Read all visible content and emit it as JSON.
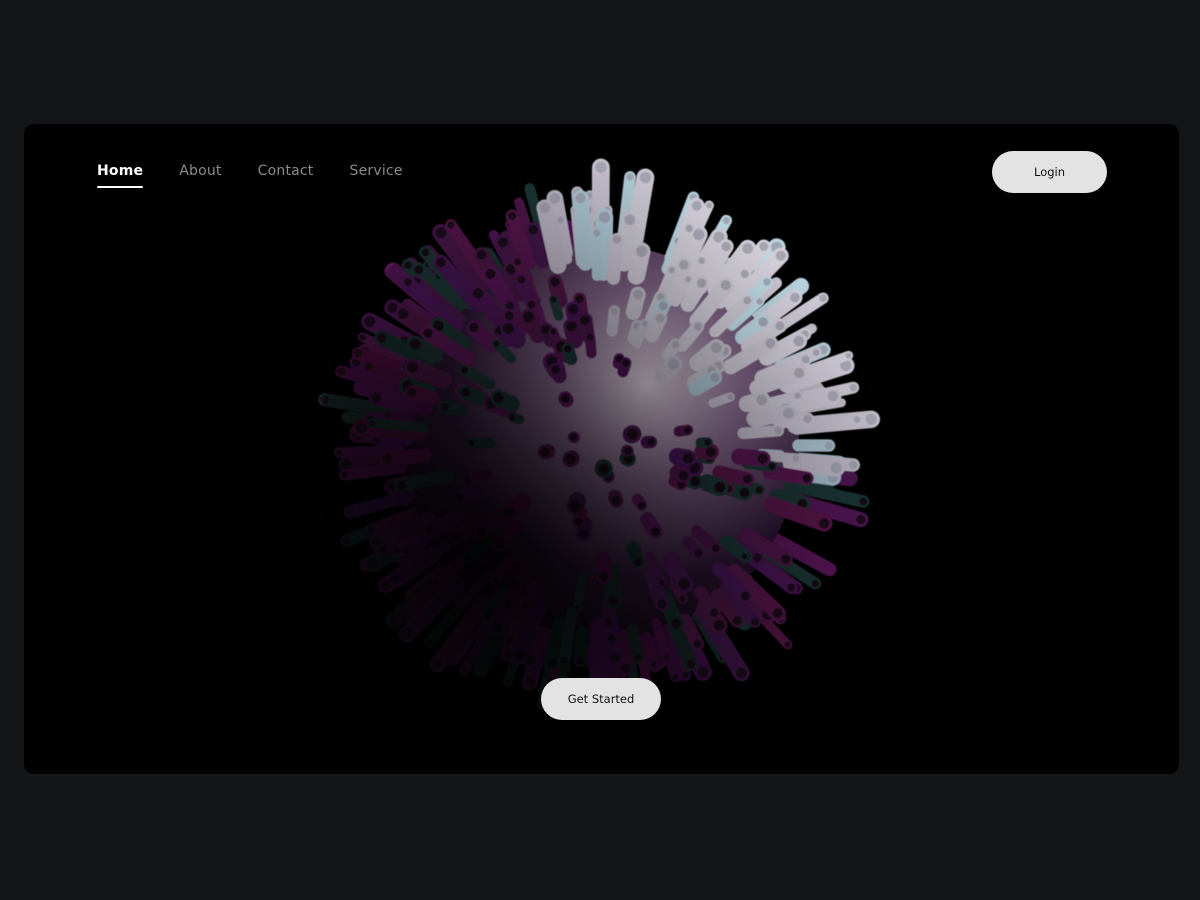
{
  "nav": {
    "items": [
      {
        "label": "Home",
        "active": true
      },
      {
        "label": "About",
        "active": false
      },
      {
        "label": "Contact",
        "active": false
      },
      {
        "label": "Service",
        "active": false
      }
    ]
  },
  "header": {
    "login_label": "Login"
  },
  "hero": {
    "cta_label": "Get Started",
    "art_name": "3d-spiky-sphere-illustration"
  },
  "colors": {
    "page_bg": "#141516",
    "frame_bg": "#010101",
    "button_bg": "#e3e3e3",
    "nav_active": "#ffffff",
    "nav_inactive": "#8a8a8a"
  }
}
